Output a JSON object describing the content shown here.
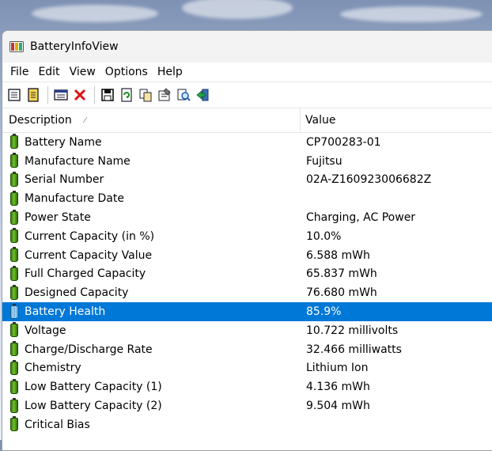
{
  "window": {
    "title": "BatteryInfoView"
  },
  "menu": [
    "File",
    "Edit",
    "View",
    "Options",
    "Help"
  ],
  "toolbar_icons": [
    "html-report-icon",
    "text-report-icon",
    "sep",
    "properties-window-icon",
    "delete-icon",
    "sep",
    "save-icon",
    "refresh-icon",
    "copy-icon",
    "properties-icon",
    "find-icon",
    "exit-icon"
  ],
  "columns": {
    "description": "Description",
    "value": "Value"
  },
  "rows": [
    {
      "description": "Battery Name",
      "value": "CP700283-01"
    },
    {
      "description": "Manufacture Name",
      "value": "Fujitsu"
    },
    {
      "description": "Serial Number",
      "value": "02A-Z160923006682Z"
    },
    {
      "description": "Manufacture Date",
      "value": ""
    },
    {
      "description": "Power State",
      "value": "Charging, AC Power"
    },
    {
      "description": "Current Capacity (in %)",
      "value": "10.0%"
    },
    {
      "description": "Current Capacity Value",
      "value": "6.588 mWh"
    },
    {
      "description": "Full Charged Capacity",
      "value": "65.837 mWh"
    },
    {
      "description": "Designed Capacity",
      "value": "76.680 mWh"
    },
    {
      "description": "Battery Health",
      "value": "85.9%",
      "selected": true
    },
    {
      "description": "Voltage",
      "value": "10.722 millivolts"
    },
    {
      "description": "Charge/Discharge Rate",
      "value": "32.466 milliwatts"
    },
    {
      "description": "Chemistry",
      "value": "Lithium Ion"
    },
    {
      "description": "Low Battery Capacity (1)",
      "value": "4.136 mWh"
    },
    {
      "description": "Low Battery Capacity (2)",
      "value": "9.504 mWh"
    },
    {
      "description": "Critical Bias",
      "value": ""
    }
  ],
  "colors": {
    "selection": "#0078d7",
    "battery_green": "#4f9c1a"
  }
}
